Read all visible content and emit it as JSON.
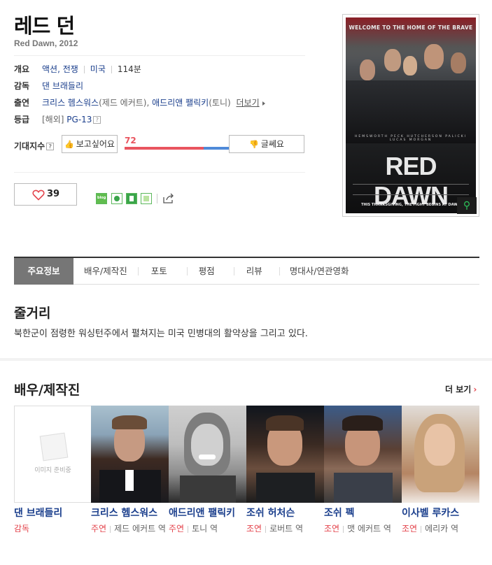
{
  "movie": {
    "title": "레드 던",
    "subtitle": "Red Dawn, 2012"
  },
  "info": {
    "summary_label": "개요",
    "genre": "액션, 전쟁",
    "country": "미국",
    "runtime": "114분",
    "director_label": "감독",
    "director": "댄 브래들리",
    "cast_label": "출연",
    "cast_1": "크리스 헴스워스",
    "cast_1_role": "(제드 에커트), ",
    "cast_2": "애드리앤 팰릭키",
    "cast_2_role": "(토니)",
    "cast_more": "더보기",
    "rating_label": "등급",
    "rating_prefix": "[해외]",
    "rating": "PG-13",
    "help_mark": "?"
  },
  "expectation": {
    "label": "기대지수",
    "want_button": "보고싶어요",
    "meh_button": "글쎄요",
    "want_value": 72,
    "meh_value": 35,
    "want_color": "#e9555f",
    "meh_color": "#4f8ad9"
  },
  "like": {
    "count": "39",
    "share_blog": "blog"
  },
  "poster": {
    "top_text": "WELCOME TO THE HOME OF THE BRAVE",
    "title_text": "RED DAWN",
    "bottom_text": "THIS THANKSGIVING, THE FIGHT BEGINS AT DAWN"
  },
  "tabs": [
    {
      "label": "주요정보"
    },
    {
      "label": "배우/제작진"
    },
    {
      "label": "포토"
    },
    {
      "label": "평점"
    },
    {
      "label": "리뷰"
    },
    {
      "label": "명대사/연관영화"
    }
  ],
  "synopsis": {
    "heading": "줄거리",
    "text": "북한군이 점령한 워싱턴주에서 펼쳐지는 미국 민병대의 활약상을 그리고 있다."
  },
  "cast_section": {
    "heading": "배우/제작진",
    "more": "더 보기",
    "no_image_text": "이미지 준비중",
    "members": [
      {
        "name": "댄 브래들리",
        "role": "감독",
        "character": ""
      },
      {
        "name": "크리스 헴스워스",
        "role": "주연",
        "character": "제드 에커트 역"
      },
      {
        "name": "애드리앤 팰릭키",
        "role": "주연",
        "character": "토니 역"
      },
      {
        "name": "조쉬 허처슨",
        "role": "조연",
        "character": "로버트 역"
      },
      {
        "name": "조쉬 펙",
        "role": "조연",
        "character": "맷 에커트 역"
      },
      {
        "name": "이사벨 루카스",
        "role": "조연",
        "character": "에리카 역"
      }
    ]
  }
}
